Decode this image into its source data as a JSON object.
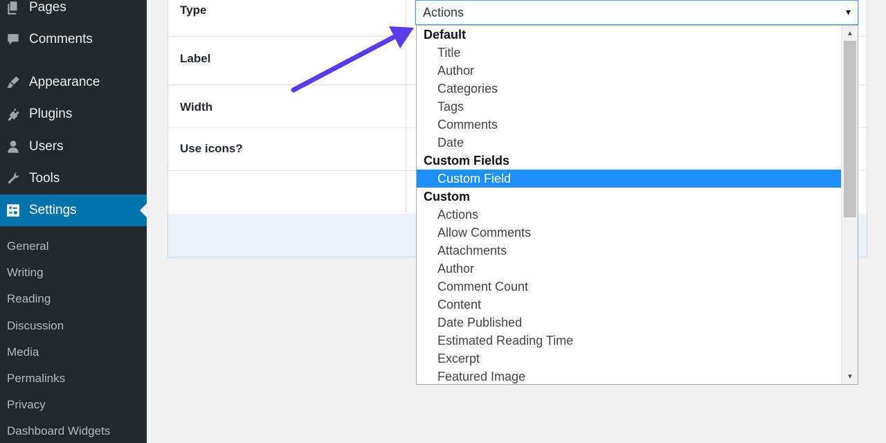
{
  "sidebar": {
    "menu": [
      {
        "label": "Pages",
        "icon": "pages-icon"
      },
      {
        "label": "Comments",
        "icon": "comments-icon"
      },
      {
        "label": "Appearance",
        "icon": "appearance-icon"
      },
      {
        "label": "Plugins",
        "icon": "plugins-icon"
      },
      {
        "label": "Users",
        "icon": "users-icon"
      },
      {
        "label": "Tools",
        "icon": "tools-icon"
      },
      {
        "label": "Settings",
        "icon": "settings-icon",
        "active": true
      }
    ],
    "submenu": [
      "General",
      "Writing",
      "Reading",
      "Discussion",
      "Media",
      "Permalinks",
      "Privacy",
      "Dashboard Widgets"
    ]
  },
  "form": {
    "rows": [
      {
        "label": "Type"
      },
      {
        "label": "Label"
      },
      {
        "label": "Width"
      },
      {
        "label": "Use icons?"
      }
    ]
  },
  "select": {
    "value": "Actions",
    "arrow": "▾"
  },
  "dropdown": {
    "items": [
      {
        "text": "Default",
        "kind": "group"
      },
      {
        "text": "Title",
        "kind": "option"
      },
      {
        "text": "Author",
        "kind": "option"
      },
      {
        "text": "Categories",
        "kind": "option"
      },
      {
        "text": "Tags",
        "kind": "option"
      },
      {
        "text": "Comments",
        "kind": "option"
      },
      {
        "text": "Date",
        "kind": "option"
      },
      {
        "text": "Custom Fields",
        "kind": "group"
      },
      {
        "text": "Custom Field",
        "kind": "option",
        "selected": true
      },
      {
        "text": "Custom",
        "kind": "group"
      },
      {
        "text": "Actions",
        "kind": "option"
      },
      {
        "text": "Allow Comments",
        "kind": "option"
      },
      {
        "text": "Attachments",
        "kind": "option"
      },
      {
        "text": "Author",
        "kind": "option"
      },
      {
        "text": "Comment Count",
        "kind": "option"
      },
      {
        "text": "Content",
        "kind": "option"
      },
      {
        "text": "Date Published",
        "kind": "option"
      },
      {
        "text": "Estimated Reading Time",
        "kind": "option"
      },
      {
        "text": "Excerpt",
        "kind": "option"
      },
      {
        "text": "Featured Image",
        "kind": "option"
      }
    ]
  },
  "colors": {
    "sidebar_bg": "#23282d",
    "active_bg": "#0073aa",
    "selected_option": "#1e90ff",
    "annotation_arrow": "#5b3be8"
  }
}
